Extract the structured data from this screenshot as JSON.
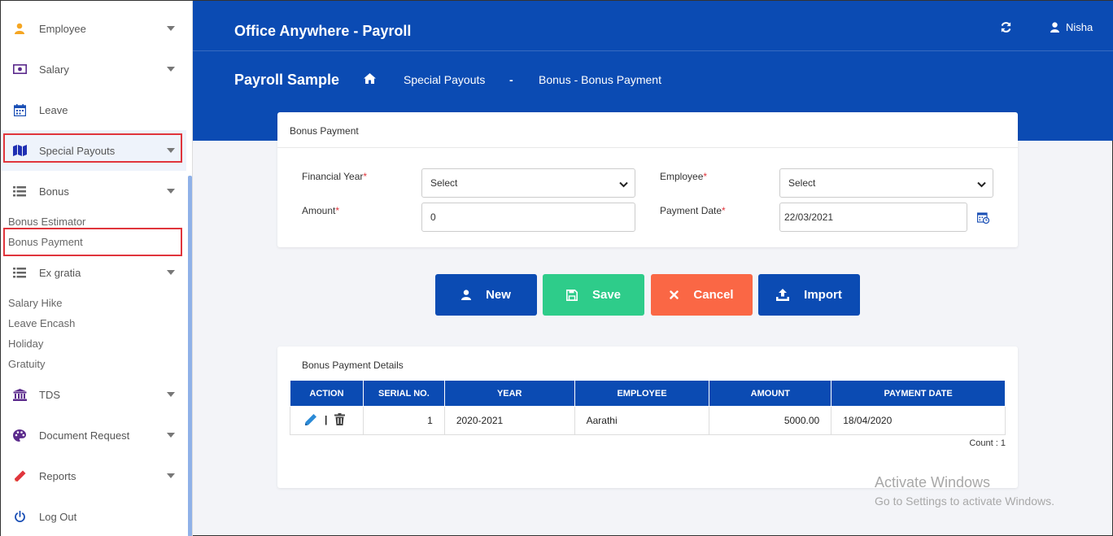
{
  "sidebar": {
    "items": [
      {
        "label": "Employee",
        "icon": "user-icon"
      },
      {
        "label": "Salary",
        "icon": "money-icon"
      },
      {
        "label": "Leave",
        "icon": "calendar-icon"
      },
      {
        "label": "Special Payouts",
        "icon": "map-icon"
      },
      {
        "label": "Bonus",
        "icon": "list-icon"
      },
      {
        "label": "Ex gratia",
        "icon": "list-icon"
      },
      {
        "label": "TDS",
        "icon": "bank-icon"
      },
      {
        "label": "Document Request",
        "icon": "palette-icon"
      },
      {
        "label": "Reports",
        "icon": "pencil-icon"
      },
      {
        "label": "Log Out",
        "icon": "power-icon"
      }
    ],
    "bonus_sub": [
      "Bonus Estimator",
      "Bonus Payment"
    ],
    "exgratia_sub": [
      "Salary Hike",
      "Leave Encash",
      "Holiday",
      "Gratuity"
    ]
  },
  "header": {
    "app_title": "Office Anywhere - Payroll",
    "user_name": "Nisha",
    "company": "Payroll Sample",
    "breadcrumb_1": "Special Payouts",
    "breadcrumb_sep": "-",
    "breadcrumb_2": "Bonus - Bonus Payment"
  },
  "form": {
    "title": "Bonus Payment",
    "financial_year_label": "Financial Year",
    "financial_year_value": "Select",
    "employee_label": "Employee",
    "employee_value": "Select",
    "amount_label": "Amount",
    "amount_value": "0",
    "payment_date_label": "Payment Date",
    "payment_date_value": "22/03/2021",
    "required_mark": "*"
  },
  "buttons": {
    "new": "New",
    "save": "Save",
    "cancel": "Cancel",
    "import": "Import",
    "colors": {
      "new": "#0b4bb3",
      "save": "#2ecc8a",
      "cancel": "#fa6745",
      "import": "#0b4bb3"
    }
  },
  "details": {
    "title": "Bonus Payment Details",
    "columns": [
      "ACTION",
      "SERIAL NO.",
      "YEAR",
      "EMPLOYEE",
      "AMOUNT",
      "PAYMENT DATE"
    ],
    "rows": [
      {
        "serial": "1",
        "year": "2020-2021",
        "employee": "Aarathi",
        "amount": "5000.00",
        "payment_date": "18/04/2020"
      }
    ],
    "action_sep": "|",
    "count": "Count : 1"
  },
  "watermark": {
    "line1": "Activate Windows",
    "line2": "Go to Settings to activate Windows."
  }
}
